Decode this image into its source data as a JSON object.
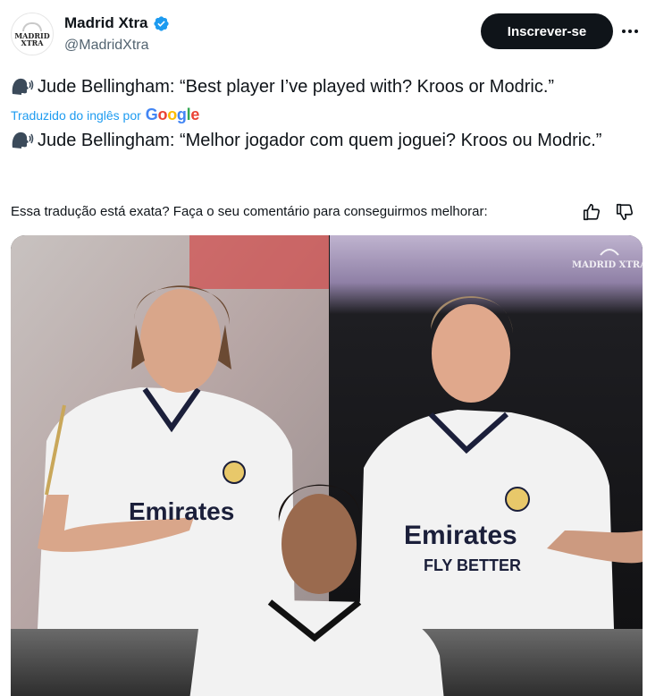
{
  "author": {
    "display_name": "Madrid Xtra",
    "handle": "@MadridXtra",
    "avatar_text": "MADRID XTRA",
    "verified_color": "#1d9bf0"
  },
  "actions": {
    "subscribe_label": "Inscrever-se"
  },
  "tweet": {
    "original_text": "Jude Bellingham: “Best player I’ve played with? Kroos or Modric.”",
    "translated_by_prefix": "Traduzido do inglês por",
    "translation_provider": "Google",
    "translated_text": "Jude Bellingham: “Melhor jogador com quem joguei? Kroos ou Modric.”"
  },
  "feedback": {
    "question": "Essa tradução está exata? Faça o seu comentário para conseguirmos melhorar:"
  },
  "media": {
    "watermark": "MADRID XTRA",
    "jersey_sponsor": "Emirates",
    "jersey_sub": "FLY BETTER"
  },
  "colors": {
    "accent": "#1d9bf0",
    "text": "#0f1419",
    "secondary": "#536471"
  }
}
